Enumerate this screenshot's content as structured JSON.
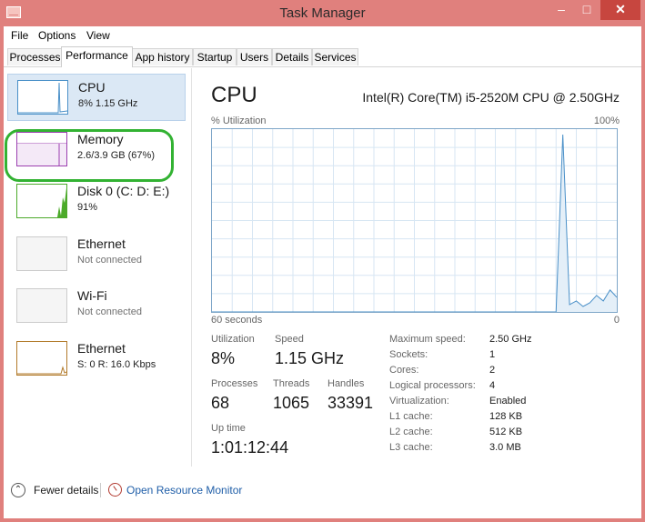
{
  "window": {
    "title": "Task Manager",
    "controls": {
      "minimize": "–",
      "maximize": "□",
      "close": "✕"
    }
  },
  "menu": [
    "File",
    "Options",
    "View"
  ],
  "tabs": [
    "Processes",
    "Performance",
    "App history",
    "Startup",
    "Users",
    "Details",
    "Services"
  ],
  "active_tab": "Performance",
  "sidebar": [
    {
      "name": "CPU",
      "detail": "8%  1.15 GHz"
    },
    {
      "name": "Memory",
      "detail": "2.6/3.9 GB (67%)"
    },
    {
      "name": "Disk 0 (C: D: E:)",
      "detail": "91%"
    },
    {
      "name": "Ethernet",
      "detail": "Not connected"
    },
    {
      "name": "Wi-Fi",
      "detail": "Not connected"
    },
    {
      "name": "Ethernet",
      "detail": "S: 0 R: 16.0 Kbps"
    }
  ],
  "main": {
    "title": "CPU",
    "processor": "Intel(R) Core(TM) i5-2520M CPU @ 2.50GHz",
    "graph_label": "% Utilization",
    "graph_max": "100%",
    "time_label": "60 seconds",
    "graph_min": "0",
    "utilization_series": [
      0,
      0,
      0,
      0,
      0,
      0,
      0,
      0,
      0,
      0,
      0,
      0,
      0,
      0,
      0,
      0,
      0,
      0,
      0,
      0,
      0,
      0,
      0,
      0,
      0,
      0,
      0,
      0,
      0,
      0,
      0,
      0,
      0,
      0,
      0,
      0,
      0,
      0,
      0,
      0,
      0,
      0,
      0,
      0,
      0,
      0,
      0,
      0,
      0,
      0,
      0,
      0,
      97,
      4,
      6,
      3,
      5,
      9,
      6,
      12,
      8
    ]
  },
  "stats": {
    "utilization": {
      "label": "Utilization",
      "value": "8%"
    },
    "speed": {
      "label": "Speed",
      "value": "1.15 GHz"
    },
    "processes": {
      "label": "Processes",
      "value": "68"
    },
    "threads": {
      "label": "Threads",
      "value": "1065"
    },
    "handles": {
      "label": "Handles",
      "value": "33391"
    },
    "uptime": {
      "label": "Up time",
      "value": "1:01:12:44"
    }
  },
  "specs": [
    {
      "label": "Maximum speed:",
      "value": "2.50 GHz"
    },
    {
      "label": "Sockets:",
      "value": "1"
    },
    {
      "label": "Cores:",
      "value": "2"
    },
    {
      "label": "Logical processors:",
      "value": "4"
    },
    {
      "label": "Virtualization:",
      "value": "Enabled"
    },
    {
      "label": "L1 cache:",
      "value": "128 KB"
    },
    {
      "label": "L2 cache:",
      "value": "512 KB"
    },
    {
      "label": "L3 cache:",
      "value": "3.0 MB"
    }
  ],
  "footer": {
    "fewer_details": "Fewer details",
    "resource_monitor": "Open Resource Monitor"
  },
  "colors": {
    "title_bar": "#e0807d",
    "close_button": "#c7463f",
    "cpu_graph": "#4a90c8",
    "memory_graph": "#9b3fb0",
    "disk_graph": "#4caa2a",
    "ethernet_graph": "#b27a2a",
    "highlight": "#32b232",
    "link": "#1f5ea8"
  }
}
